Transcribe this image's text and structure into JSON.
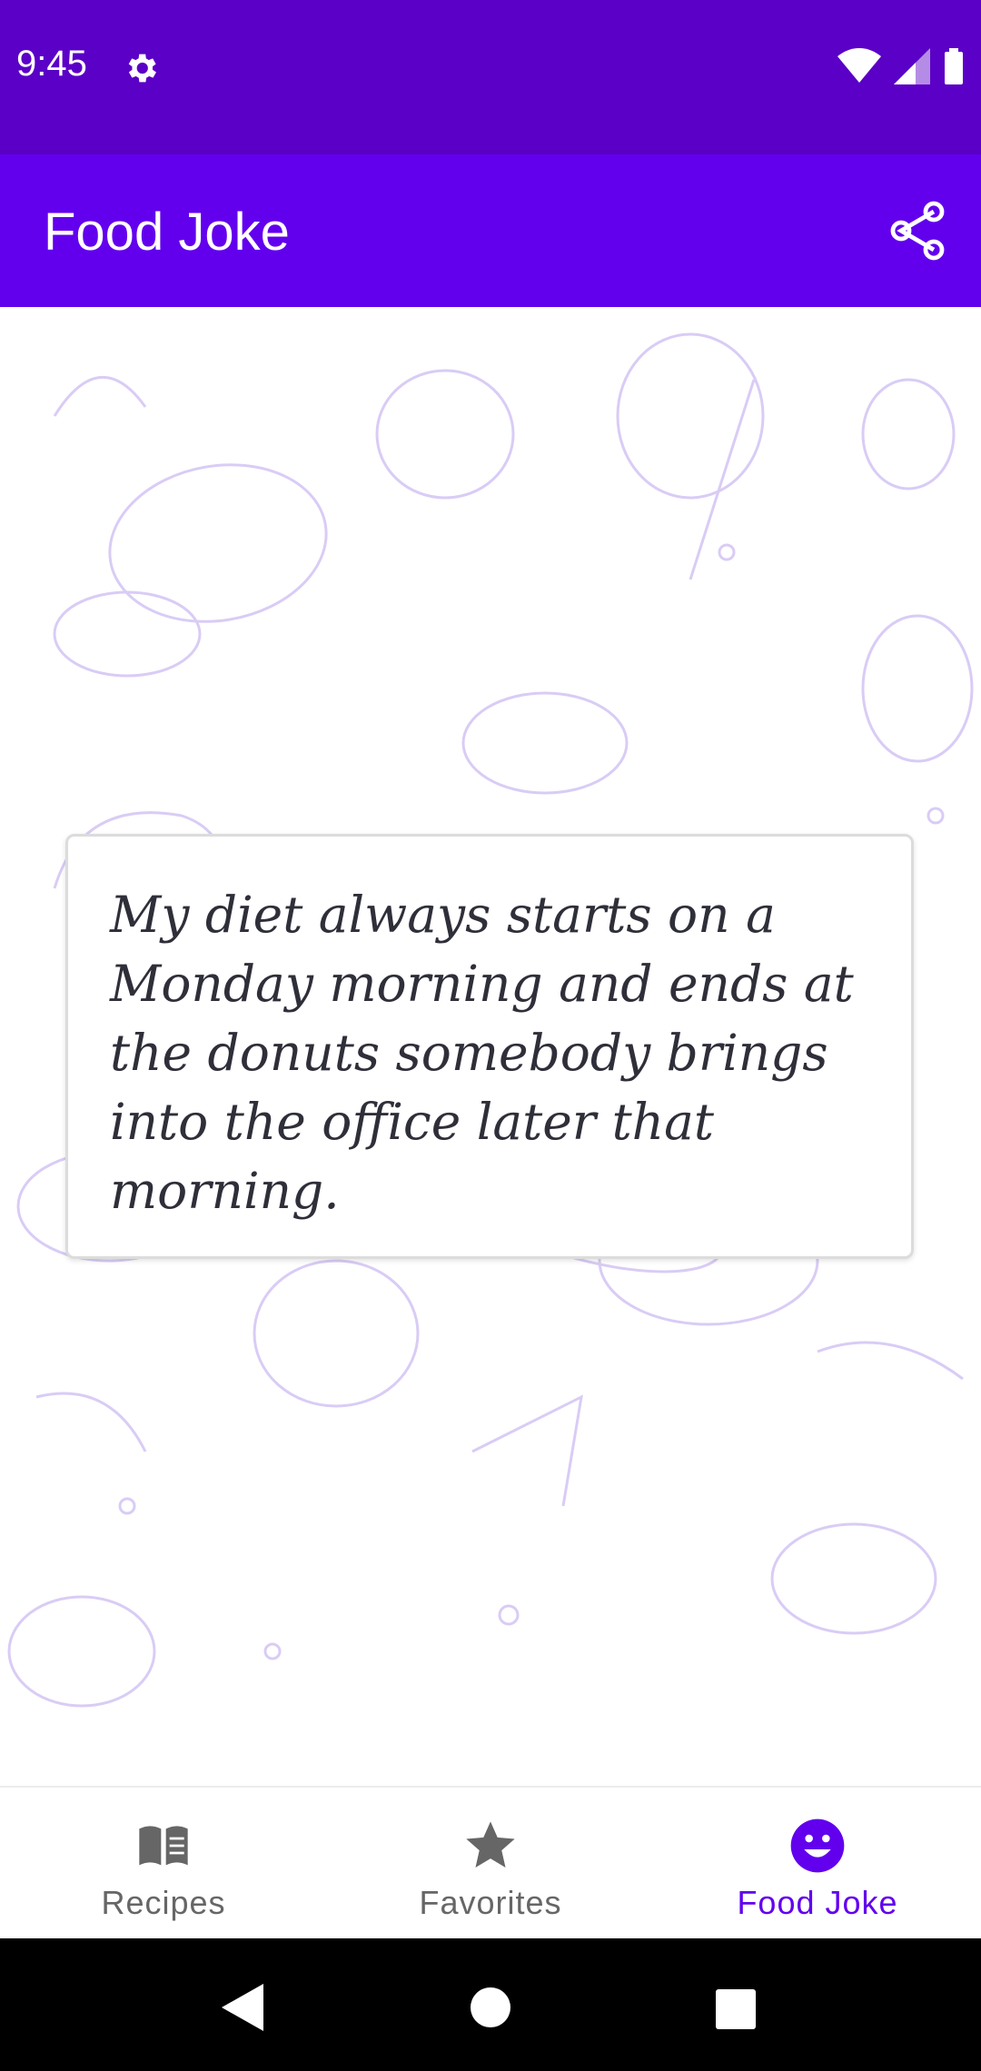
{
  "status_bar": {
    "time": "9:45",
    "icons": [
      "gear-icon",
      "wifi-icon",
      "cellular-signal-icon",
      "battery-icon"
    ]
  },
  "app_bar": {
    "title": "Food Joke",
    "action_icon": "share-icon"
  },
  "joke": {
    "text": "My diet always starts on a Monday morning and ends at the donuts somebody brings into the office later that morning."
  },
  "bottom_nav": {
    "items": [
      {
        "label": "Recipes",
        "icon": "book-icon",
        "selected": false
      },
      {
        "label": "Favorites",
        "icon": "star-icon",
        "selected": false
      },
      {
        "label": "Food Joke",
        "icon": "smiley-icon",
        "selected": true
      }
    ],
    "active_color": "#6200ee",
    "inactive_color": "#666666"
  },
  "system_nav": {
    "buttons": [
      "back-icon",
      "home-icon",
      "recents-icon"
    ]
  },
  "colors": {
    "status_bar": "#5b00c6",
    "app_bar": "#6200ee",
    "pattern": "#d9ccf5"
  }
}
